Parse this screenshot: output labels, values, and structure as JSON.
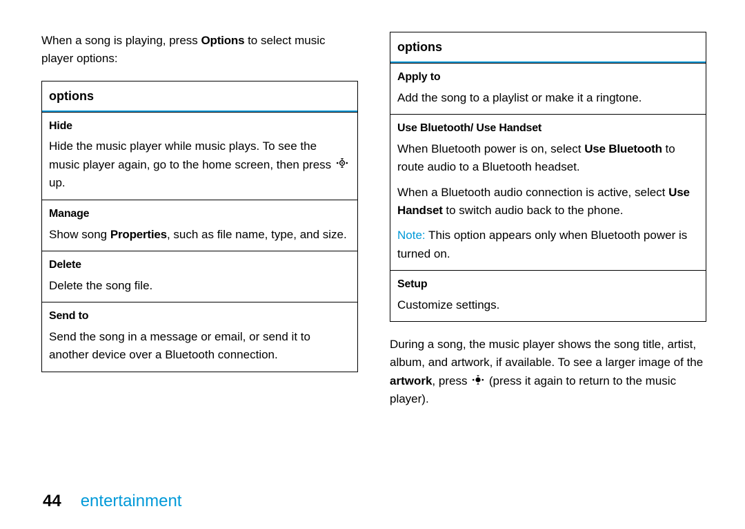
{
  "intro": {
    "prefix": "When a song is playing, press ",
    "bold": "Options",
    "suffix": " to select music player options:"
  },
  "table_left": {
    "header": "options",
    "rows": [
      {
        "title": "Hide",
        "body_prefix": "Hide the music player while music plays. To see the music player again, go to the home screen, then press ",
        "body_suffix": " up."
      },
      {
        "title": "Manage",
        "body_prefix": "Show song ",
        "bold_inline": "Properties",
        "body_suffix": ", such as file name, type, and size."
      },
      {
        "title": "Delete",
        "body": "Delete the song file."
      },
      {
        "title": "Send to",
        "body": "Send the song in a message or email, or send it to another device over a Bluetooth connection."
      }
    ]
  },
  "table_right": {
    "header": "options",
    "rows": [
      {
        "title": "Apply to",
        "body": "Add the song to a playlist or make it a ringtone."
      },
      {
        "title": "Use Bluetooth/ Use Handset",
        "p1_prefix": "When Bluetooth power is on, select ",
        "p1_bold": "Use Bluetooth",
        "p1_suffix": " to route audio to a Bluetooth headset.",
        "p2_prefix": "When a Bluetooth audio connection is active, select ",
        "p2_bold": "Use Handset",
        "p2_suffix": " to switch audio back to the phone.",
        "note_label": "Note:",
        "note_body": " This option appears only when Bluetooth power is turned on."
      },
      {
        "title": "Setup",
        "body": "Customize settings."
      }
    ]
  },
  "outro": {
    "prefix": "During a song, the music player shows the song title, artist, album, and artwork, if available. To see a larger image of the ",
    "bold": "artwork",
    "mid": ", press ",
    "suffix": " (press it again to return to the music player)."
  },
  "footer": {
    "page": "44",
    "section": "entertainment"
  }
}
